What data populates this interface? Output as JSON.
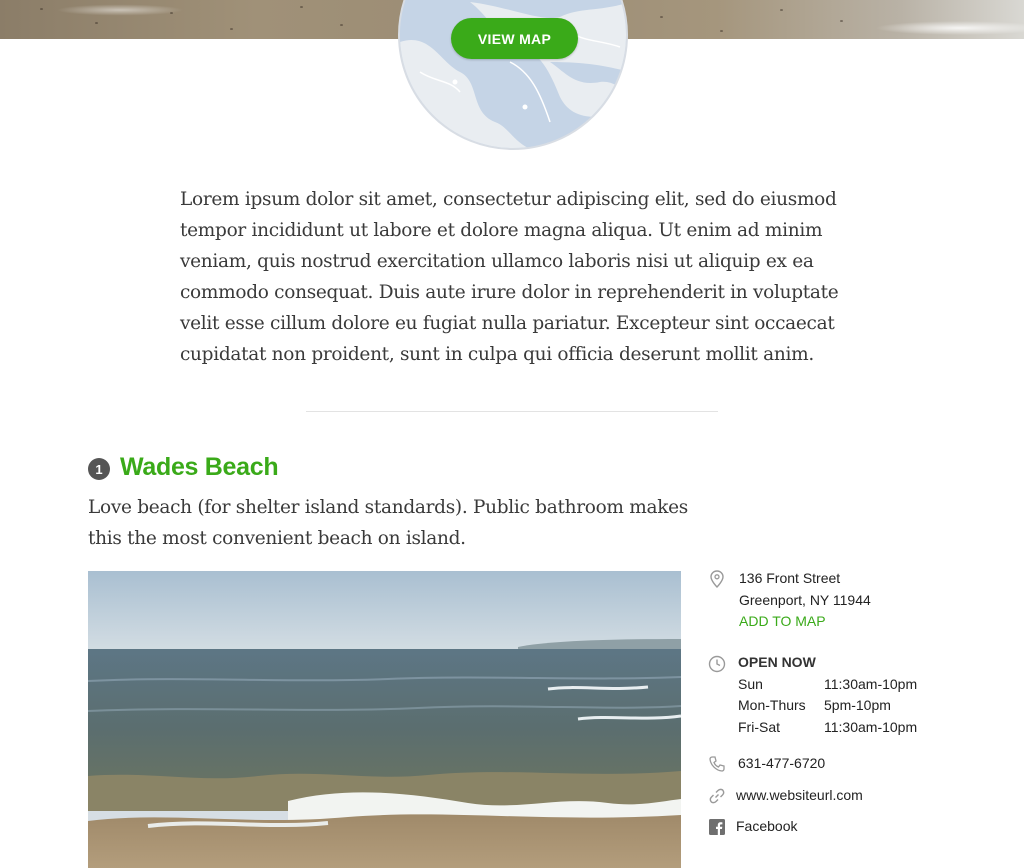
{
  "map": {
    "button_label": "VIEW MAP"
  },
  "intro": {
    "text": "Lorem ipsum dolor sit amet, consectetur adipiscing elit, sed do eiusmod tempor incididunt ut labore et dolore magna aliqua. Ut enim ad minim veniam, quis nostrud exercitation ullamco laboris nisi ut aliquip ex ea commodo consequat. Duis aute irure dolor in reprehenderit in voluptate velit esse cillum dolore eu fugiat nulla pariatur. Excepteur sint occaecat cupidatat non proident, sunt in culpa qui officia deserunt mollit anim."
  },
  "place": {
    "number": "1",
    "title": "Wades Beach",
    "description": "Love beach (for shelter island standards). Public bathroom makes this the most convenient beach on island.",
    "address_line1": "136 Front Street",
    "address_line2": "Greenport, NY 11944",
    "add_to_map": "ADD TO MAP",
    "open_status": "OPEN NOW",
    "hours": [
      {
        "day": "Sun",
        "time": "11:30am-10pm"
      },
      {
        "day": "Mon-Thurs",
        "time": "5pm-10pm"
      },
      {
        "day": "Fri-Sat",
        "time": "11:30am-10pm"
      }
    ],
    "phone": "631-477-6720",
    "website": "www.websiteurl.com",
    "facebook": "Facebook"
  },
  "colors": {
    "accent_green": "#3aaa19",
    "text": "#3a3a3a",
    "icon_gray": "#9a9a9a"
  },
  "icons": {
    "address": "map-pin-icon",
    "hours": "clock-icon",
    "phone": "phone-icon",
    "website": "link-icon",
    "facebook": "facebook-icon"
  }
}
